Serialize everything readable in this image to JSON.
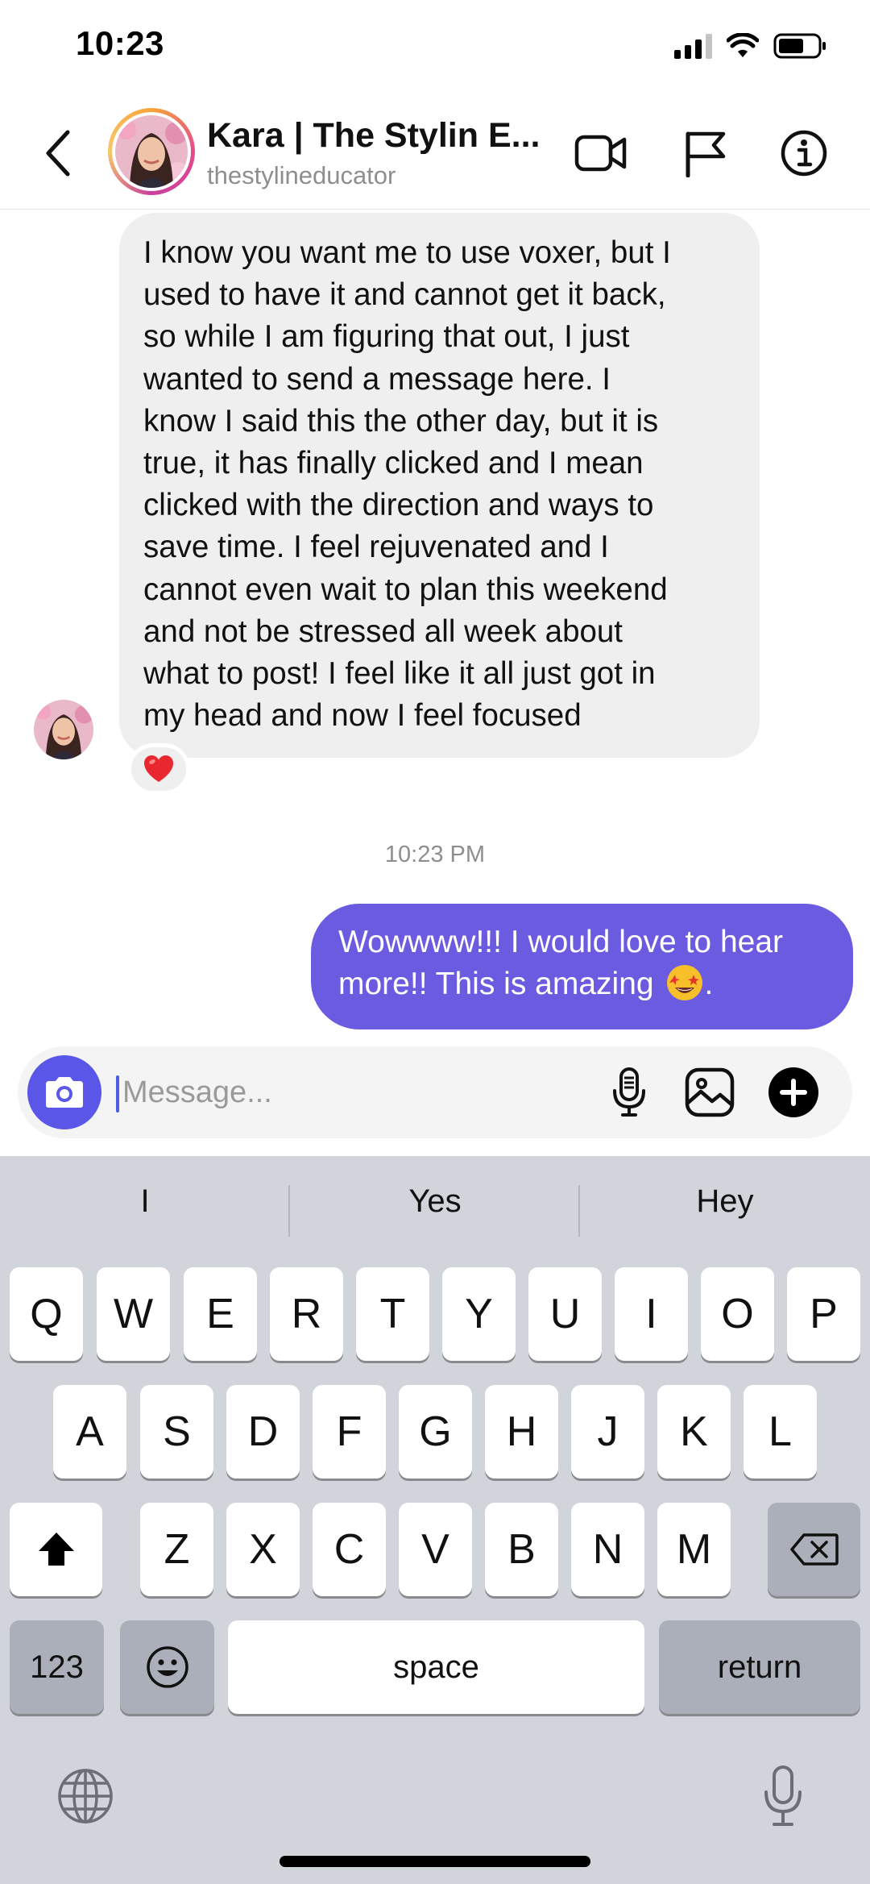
{
  "status_bar": {
    "time": "10:23"
  },
  "header": {
    "name": "Kara | The Stylin E...",
    "username": "thestylineducator"
  },
  "messages": {
    "incoming": {
      "text": "I know you want me to use voxer, but I\nused to have it and cannot get it back,\nso while I am figuring that out, I just\nwanted to send a message here. I\nknow I said this the other day, but it is\ntrue, it has finally clicked and I mean\nclicked with the direction and ways to\nsave time. I feel rejuvenated and I\ncannot even wait to plan this weekend\nand not be stressed all week about\nwhat to post! I feel like it all just got in\nmy head and now I feel focused",
      "reaction": "❤️"
    },
    "timestamp": "10:23 PM",
    "outgoing": {
      "text": "Wowwww!!! I would love to hear\nmore!! This is amazing",
      "text_end": "."
    }
  },
  "composer": {
    "placeholder": "Message..."
  },
  "keyboard": {
    "suggestions": [
      "I",
      "Yes",
      "Hey"
    ],
    "row1": [
      "Q",
      "W",
      "E",
      "R",
      "T",
      "Y",
      "U",
      "I",
      "O",
      "P"
    ],
    "row2": [
      "A",
      "S",
      "D",
      "F",
      "G",
      "H",
      "J",
      "K",
      "L"
    ],
    "row3": [
      "Z",
      "X",
      "C",
      "V",
      "B",
      "N",
      "M"
    ],
    "numbers_label": "123",
    "space_label": "space",
    "return_label": "return"
  },
  "colors": {
    "outgoing_bubble": "#6a5be0",
    "incoming_bubble": "#efefef",
    "camera_button": "#5a57e8",
    "keyboard_bg": "#d1d4db"
  },
  "icons": [
    "back-chevron-icon",
    "video-call-icon",
    "flag-icon",
    "info-icon",
    "camera-icon",
    "microphone-icon",
    "gallery-icon",
    "add-icon",
    "shift-icon",
    "backspace-icon",
    "emoji-icon",
    "globe-icon",
    "dictation-icon"
  ]
}
